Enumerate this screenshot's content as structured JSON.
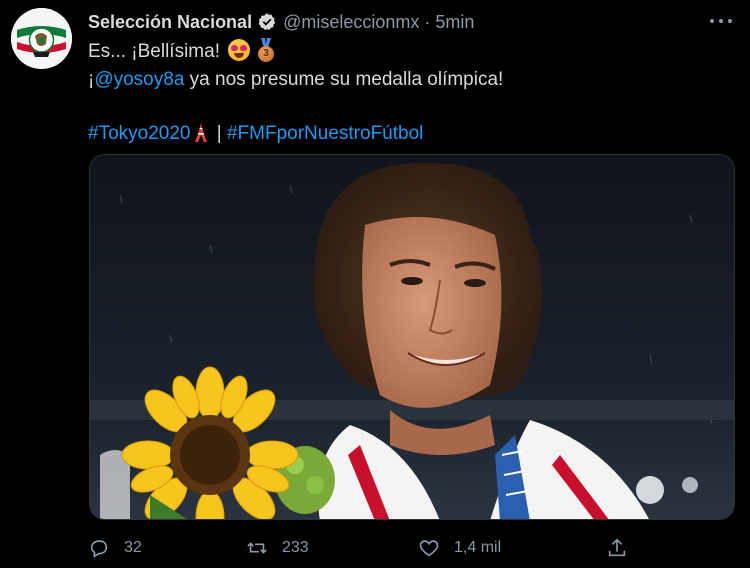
{
  "tweet": {
    "author_name": "Selección Nacional",
    "handle": "@miseleccionmx",
    "separator": "·",
    "time": "5min",
    "line1": "Es... ¡Bellísima!",
    "line2_prefix": "¡",
    "mention": "@yosoy8a",
    "line2_rest": " ya nos presume su medalla olímpica!",
    "hashtag1": "#Tokyo2020",
    "hashtag_separator": " | ",
    "hashtag2": "#FMFporNuestroFútbol",
    "emojis": [
      "heart-eyes-emoji",
      "bronze-medal-emoji",
      "tokyo-tower-emoji"
    ],
    "medal_number": "3"
  },
  "actions": {
    "reply_count": "32",
    "retweet_count": "233",
    "like_count": "1,4 mil"
  },
  "colors": {
    "background": "#000000",
    "text": "#d9d9d9",
    "secondary": "#8b98a5",
    "link": "#1d9bf0",
    "verified": "#d9d9d9"
  },
  "icons": [
    "more-icon",
    "verified-icon",
    "reply-icon",
    "retweet-icon",
    "like-icon",
    "share-icon"
  ]
}
